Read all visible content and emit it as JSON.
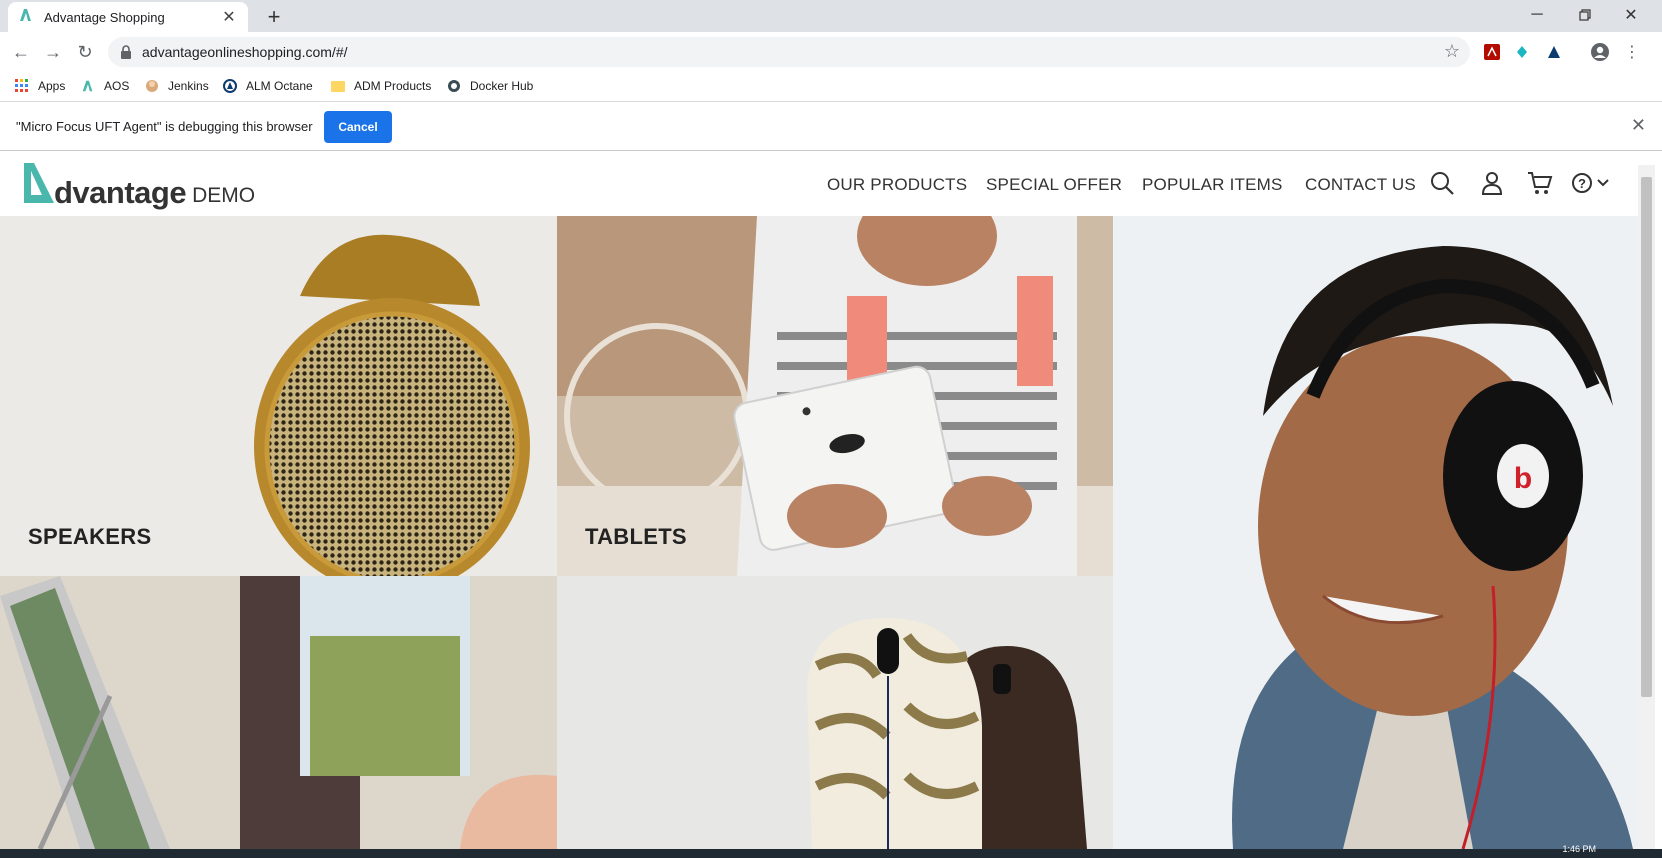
{
  "browser": {
    "tab_title": "Advantage Shopping",
    "url": "advantageonlineshopping.com/#/",
    "bookmarks": [
      "Apps",
      "AOS",
      "Jenkins",
      "ALM Octane",
      "ADM Products",
      "Docker Hub"
    ],
    "infobar_text": "\"Micro Focus UFT Agent\" is debugging this browser",
    "infobar_cancel": "Cancel"
  },
  "site": {
    "logo_word": "dvantage",
    "logo_demo": "DEMO",
    "nav": [
      "OUR PRODUCTS",
      "SPECIAL OFFER",
      "POPULAR ITEMS",
      "CONTACT US"
    ],
    "categories": [
      "SPEAKERS",
      "TABLETS"
    ]
  },
  "colors": {
    "accent": "#1a73e8",
    "logo_teal": "#4ab7ad"
  },
  "taskbar": {
    "clock": "1:46 PM"
  }
}
